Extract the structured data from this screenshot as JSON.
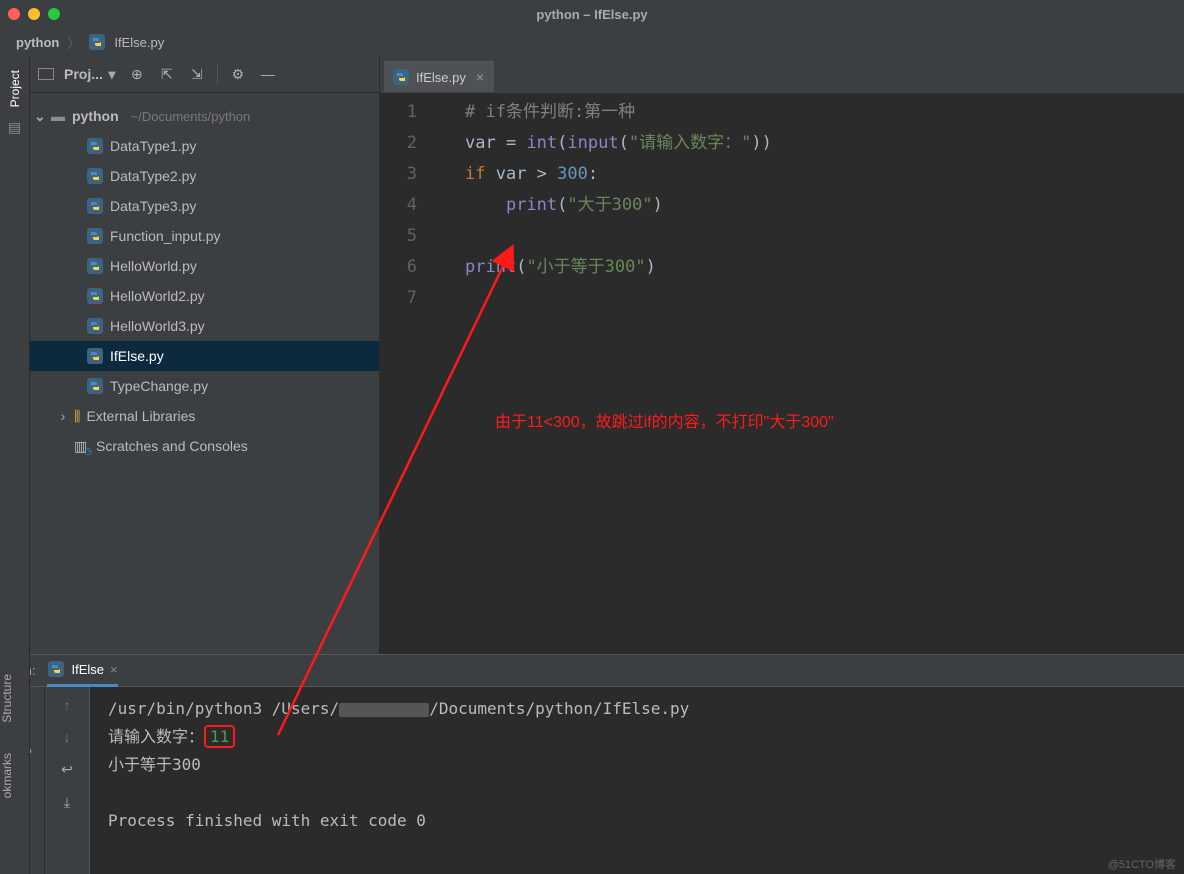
{
  "window": {
    "title": "python – IfElse.py"
  },
  "breadcrumb": {
    "project": "python",
    "file": "IfElse.py"
  },
  "panel": {
    "title": "Proj...",
    "root_name": "python",
    "root_path": "~/Documents/python"
  },
  "tree": {
    "files": [
      "DataType1.py",
      "DataType2.py",
      "DataType3.py",
      "Function_input.py",
      "HelloWorld.py",
      "HelloWorld2.py",
      "HelloWorld3.py",
      "IfElse.py",
      "TypeChange.py"
    ],
    "selected": "IfElse.py",
    "ext_lib": "External Libraries",
    "scratches": "Scratches and Consoles"
  },
  "tab": {
    "name": "IfElse.py"
  },
  "gutter": [
    "1",
    "2",
    "3",
    "4",
    "5",
    "6",
    "7"
  ],
  "code": {
    "l1": {
      "comment": "# if条件判断:第一种"
    },
    "l2": {
      "id": "var",
      "eq": " = ",
      "fn1": "int",
      "p1": "(",
      "fn2": "input",
      "p2": "(",
      "str": "\"请输入数字：\"",
      "p3": "))"
    },
    "l3": {
      "kw": "if ",
      "id": "var",
      "op": " > ",
      "num": "300",
      "colon": ":"
    },
    "l4": {
      "indent": "    ",
      "fn": "print",
      "p1": "(",
      "str": "\"大于300\"",
      "p2": ")"
    },
    "l5": "",
    "l6": {
      "fn": "print",
      "p1": "(",
      "str": "\"小于等于300\"",
      "p2": ")"
    }
  },
  "annotation": "由于11<300，故跳过if的内容，不打印\"大于300\"",
  "run": {
    "label": "Run:",
    "tab": "IfElse",
    "cmd_pre": "/usr/bin/python3  /Users/",
    "cmd_post": "/Documents/python/IfElse.py",
    "prompt": "请输入数字：",
    "input_val": "11",
    "out1": "小于等于300",
    "exit": "Process finished with exit code 0"
  },
  "side": {
    "project": "Project",
    "structure": "Structure",
    "bookmarks": "okmarks"
  },
  "watermark": "@51CTO博客"
}
